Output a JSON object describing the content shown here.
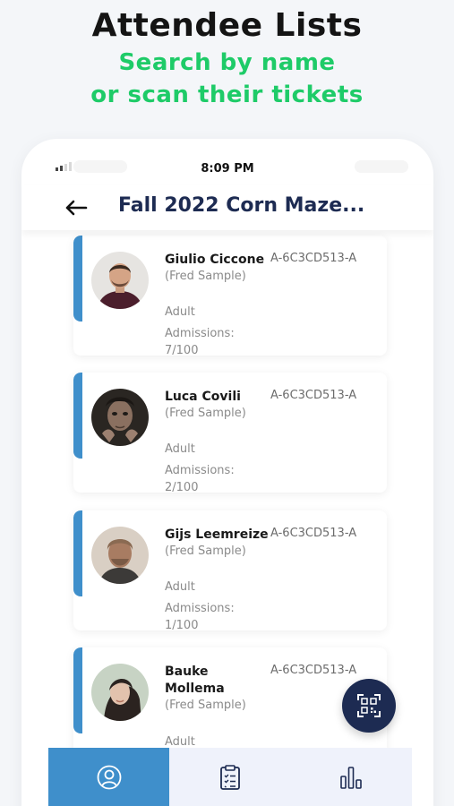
{
  "promo": {
    "title": "Attendee Lists",
    "subtitle_line1": "Search by name",
    "subtitle_line2": "or scan their tickets"
  },
  "status_bar": {
    "time": "8:09 PM"
  },
  "app_bar": {
    "title": "Fall 2022 Corn Maze..."
  },
  "attendees": [
    {
      "name": "Giulio  Ciccone",
      "purchaser": "(Fred Sample)",
      "ticket_code": "A-6C3CD513-A",
      "ticket_type": "Adult",
      "admissions_label": "Admissions:",
      "admissions_value": "7/100"
    },
    {
      "name": "Luca Covili",
      "purchaser": "(Fred Sample)",
      "ticket_code": "A-6C3CD513-A",
      "ticket_type": "Adult",
      "admissions_label": "Admissions:",
      "admissions_value": "2/100"
    },
    {
      "name": "Gijs  Leemreize",
      "purchaser": "(Fred Sample)",
      "ticket_code": "A-6C3CD513-A",
      "ticket_type": "Adult",
      "admissions_label": "Admissions:",
      "admissions_value": "1/100"
    },
    {
      "name": "Bauke Mollema",
      "purchaser": "(Fred Sample)",
      "ticket_code": "A-6C3CD513-A",
      "ticket_type": "Adult"
    }
  ],
  "fab": {
    "icon": "qr-code-scan-icon"
  },
  "tabs": [
    {
      "icon": "user-circle-icon",
      "active": true
    },
    {
      "icon": "clipboard-list-icon",
      "active": false
    },
    {
      "icon": "bar-chart-icon",
      "active": false
    }
  ],
  "colors": {
    "accent_blue": "#3f8fcb",
    "navy": "#1d2b52",
    "promo_green": "#1ecb68"
  }
}
